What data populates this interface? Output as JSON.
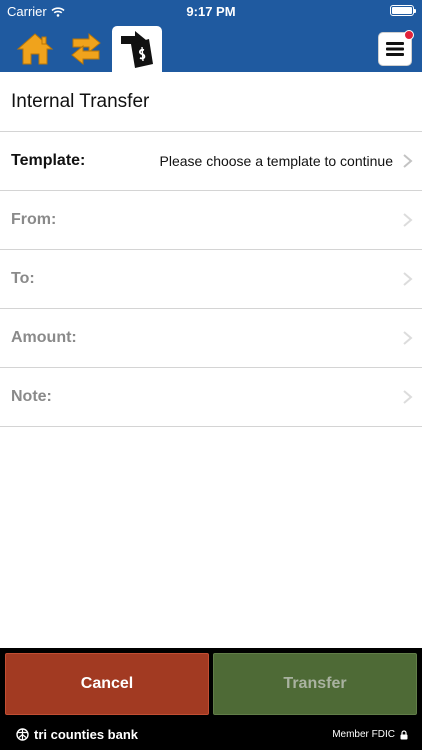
{
  "status_bar": {
    "carrier": "Carrier",
    "time": "9:17 PM"
  },
  "nav": {
    "items": [
      {
        "name": "home",
        "icon": "house-icon",
        "color": "#f0a31c"
      },
      {
        "name": "transfers",
        "icon": "transfer-arrows-icon",
        "color": "#f0a31c"
      },
      {
        "name": "internal-transfer",
        "icon": "money-transfer-icon",
        "active": true
      }
    ],
    "menu_icon": "hamburger-icon",
    "badge_color": "#e2233a"
  },
  "page": {
    "title": "Internal Transfer"
  },
  "form": {
    "rows": [
      {
        "label": "Template:",
        "value": "Please choose a template to continue",
        "active": true
      },
      {
        "label": "From:",
        "value": ""
      },
      {
        "label": "To:",
        "value": ""
      },
      {
        "label": "Amount:",
        "value": ""
      },
      {
        "label": "Note:",
        "value": ""
      }
    ]
  },
  "actions": {
    "cancel": "Cancel",
    "transfer": "Transfer"
  },
  "footer": {
    "brand": "tri counties bank",
    "member": "Member FDIC"
  },
  "colors": {
    "header_bg": "#1f5aa0",
    "cancel_bg": "#a23a22",
    "transfer_bg": "#4e6a36"
  }
}
